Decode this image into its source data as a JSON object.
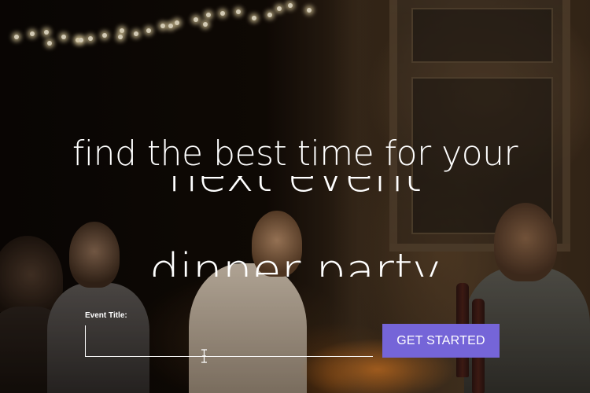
{
  "hero": {
    "headline": "find the best time for your",
    "rotating_words": [
      "next event",
      "dinner party"
    ]
  },
  "form": {
    "event_title_label": "Event Title:",
    "event_title_value": "",
    "event_title_placeholder": "",
    "submit_label": "GET STARTED"
  },
  "colors": {
    "button_bg": "#7565d8",
    "text": "#ffffff"
  },
  "icons": {
    "text_cursor": "i-beam-cursor-icon"
  }
}
